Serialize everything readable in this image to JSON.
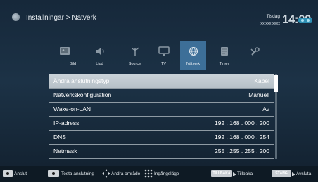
{
  "header": {
    "breadcrumb": "Inställningar > Nätverk",
    "day": "Tisdag",
    "date": "xx xxx xxxx",
    "time": "14:00"
  },
  "categories": [
    {
      "label": "",
      "icon": "picture-icon"
    },
    {
      "label": "Bild",
      "icon": "picture-icon"
    },
    {
      "label": "Ljud",
      "icon": "speaker-icon"
    },
    {
      "label": "Source",
      "icon": "source-antenna-icon"
    },
    {
      "label": "TV",
      "icon": "tv-icon"
    },
    {
      "label": "Nätverk",
      "icon": "network-globe-icon",
      "active": true
    },
    {
      "label": "Timer",
      "icon": "timer-icon"
    },
    {
      "label": "",
      "icon": "tools-icon"
    }
  ],
  "settings": {
    "rows": [
      {
        "key": "Ändra anslutningstyp",
        "value": "Kabel",
        "selected": true
      },
      {
        "key": "Nätverkskonfiguration",
        "value": "Manuell"
      },
      {
        "key": "Wake-on-LAN",
        "value": "Av"
      },
      {
        "key": "IP-adress",
        "value": "192 . 168 . 000 . 200"
      },
      {
        "key": "DNS",
        "value": "192 . 168 . 000 . 254"
      },
      {
        "key": "Netmask",
        "value": "255 . 255 . 255 . 200"
      }
    ]
  },
  "footer": {
    "connect": "Anslut",
    "test": "Testa anslutning",
    "change_area": "Ändra område",
    "input_mode": "Ingångsläge",
    "back_tag": "TILLBAKA",
    "back": "Tillbaka",
    "close_tag": "STÄNG",
    "close": "Avsluta"
  },
  "colors": {
    "accent": "#3d6f98",
    "selected_row": "#c9d2d8",
    "background": "#16283a"
  }
}
